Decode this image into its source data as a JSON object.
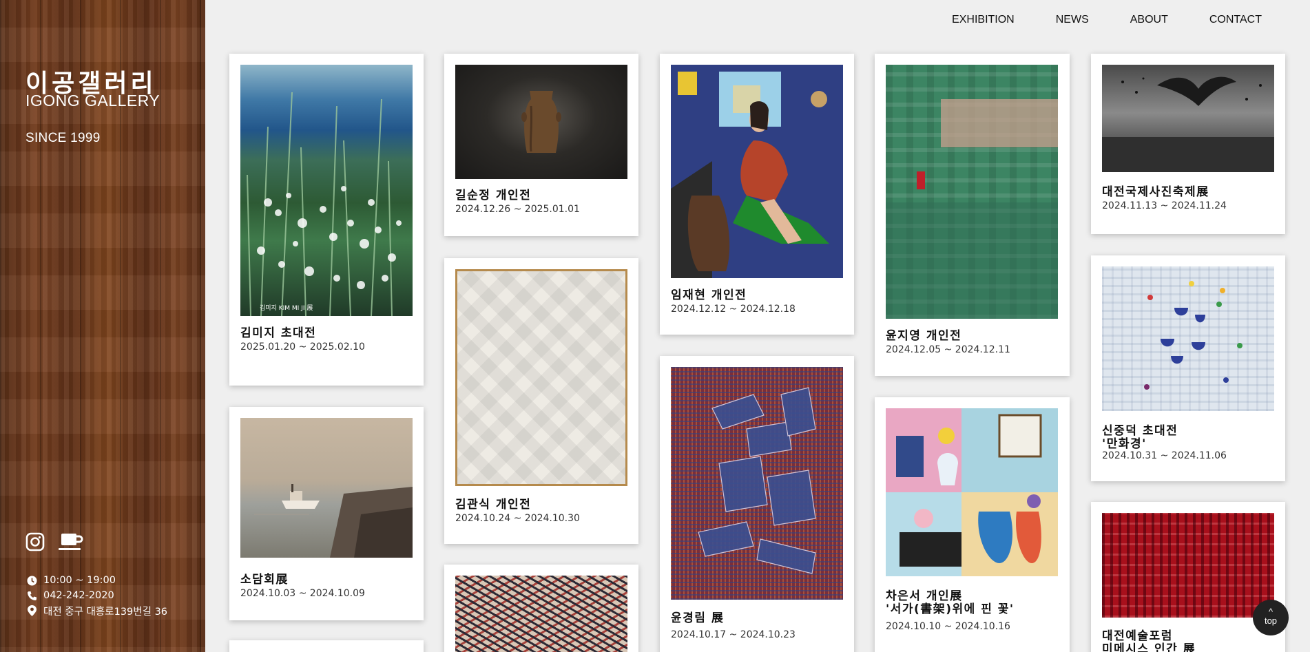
{
  "sidebar": {
    "title_kr": "이공갤러리",
    "title_en": "IGONG GALLERY",
    "since": "SINCE 1999",
    "hours": "10:00 ~ 19:00",
    "phone": "042-242-2020",
    "address": "대전 중구 대흥로139번길 36"
  },
  "nav": [
    "EXHIBITION",
    "NEWS",
    "ABOUT",
    "CONTACT"
  ],
  "cards": [
    {
      "title": "김미지 초대전",
      "date": "2025.01.20 ~ 2025.02.10",
      "poster_text": "김미지  KIM MI JI 展"
    },
    {
      "title": "길순정 개인전",
      "date": "2024.12.26 ~ 2025.01.01"
    },
    {
      "title": "임재현 개인전",
      "date": "2024.12.12 ~ 2024.12.18"
    },
    {
      "title": "윤지영 개인전",
      "date": "2024.12.05 ~ 2024.12.11"
    },
    {
      "title": "대전국제사진축제展",
      "date": "2024.11.13 ~ 2024.11.24"
    },
    {
      "title": "김관식 개인전",
      "date": "2024.10.24 ~ 2024.10.30"
    },
    {
      "title": "신중덕 초대전\n'만화경'",
      "date": "2024.10.31 ~ 2024.11.06"
    },
    {
      "title": "소담회展",
      "date": "2024.10.03 ~ 2024.10.09"
    },
    {
      "title": "윤경림 展",
      "date": "2024.10.17 ~ 2024.10.23"
    },
    {
      "title": "차은서 개인展\n'서가(書架)위에 핀 꽃'",
      "date": "2024.10.10 ~ 2024.10.16"
    },
    {
      "title": "대전예술포럼\n미메시스 인간 展",
      "date": ""
    }
  ],
  "top_button": {
    "arrow": "^",
    "label": "top"
  },
  "colors": {
    "background": "#efefef",
    "card": "#ffffff",
    "text": "#111111"
  }
}
